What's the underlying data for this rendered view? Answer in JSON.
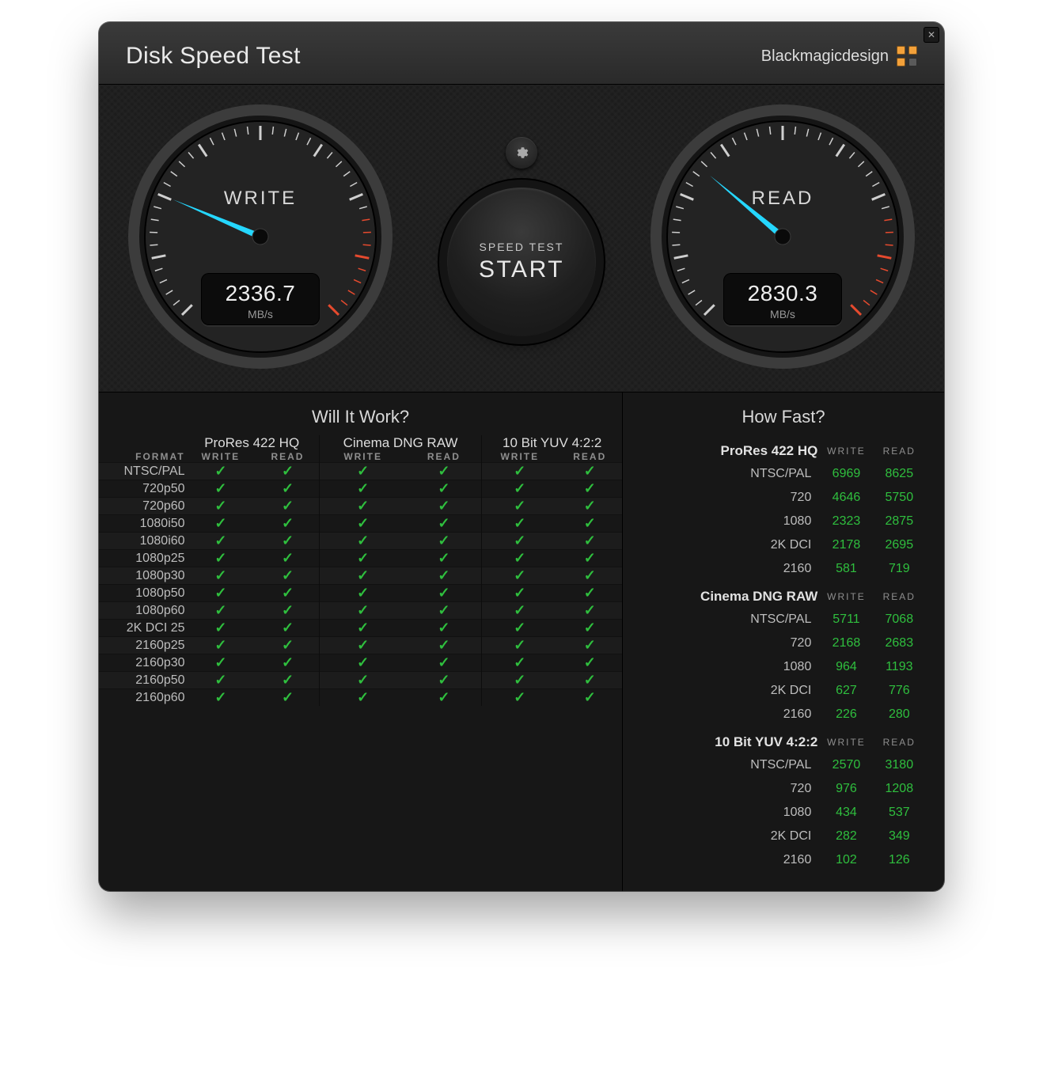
{
  "app": {
    "title": "Disk Speed Test",
    "brand": "Blackmagicdesign",
    "brand_colors": [
      "#f3a13a",
      "#f3a13a",
      "#f3a13a",
      "#5a5a5a"
    ]
  },
  "controls": {
    "start_line1": "SPEED TEST",
    "start_line2": "START",
    "settings_icon": "gear-icon"
  },
  "gauges": {
    "unit": "MB/s",
    "max": 8000,
    "write": {
      "label": "WRITE",
      "value": "2336.7",
      "needle_deg": -67
    },
    "read": {
      "label": "READ",
      "value": "2830.3",
      "needle_deg": -50
    }
  },
  "will_it_work": {
    "title": "Will It Work?",
    "format_header": "FORMAT",
    "sub_write": "WRITE",
    "sub_read": "READ",
    "codecs": [
      "ProRes 422 HQ",
      "Cinema DNG RAW",
      "10 Bit YUV 4:2:2"
    ],
    "formats": [
      "NTSC/PAL",
      "720p50",
      "720p60",
      "1080i50",
      "1080i60",
      "1080p25",
      "1080p30",
      "1080p50",
      "1080p60",
      "2K DCI 25",
      "2160p25",
      "2160p30",
      "2160p50",
      "2160p60"
    ],
    "all_checked": true
  },
  "how_fast": {
    "title": "How Fast?",
    "write_header": "WRITE",
    "read_header": "READ",
    "groups": [
      {
        "name": "ProRes 422 HQ",
        "rows": [
          {
            "label": "NTSC/PAL",
            "write": 6969,
            "read": 8625
          },
          {
            "label": "720",
            "write": 4646,
            "read": 5750
          },
          {
            "label": "1080",
            "write": 2323,
            "read": 2875
          },
          {
            "label": "2K DCI",
            "write": 2178,
            "read": 2695
          },
          {
            "label": "2160",
            "write": 581,
            "read": 719
          }
        ]
      },
      {
        "name": "Cinema DNG RAW",
        "rows": [
          {
            "label": "NTSC/PAL",
            "write": 5711,
            "read": 7068
          },
          {
            "label": "720",
            "write": 2168,
            "read": 2683
          },
          {
            "label": "1080",
            "write": 964,
            "read": 1193
          },
          {
            "label": "2K DCI",
            "write": 627,
            "read": 776
          },
          {
            "label": "2160",
            "write": 226,
            "read": 280
          }
        ]
      },
      {
        "name": "10 Bit YUV 4:2:2",
        "rows": [
          {
            "label": "NTSC/PAL",
            "write": 2570,
            "read": 3180
          },
          {
            "label": "720",
            "write": 976,
            "read": 1208
          },
          {
            "label": "1080",
            "write": 434,
            "read": 537
          },
          {
            "label": "2K DCI",
            "write": 282,
            "read": 349
          },
          {
            "label": "2160",
            "write": 102,
            "read": 126
          }
        ]
      }
    ]
  },
  "chart_data": [
    {
      "type": "gauge",
      "title": "WRITE",
      "value": 2336.7,
      "unit": "MB/s",
      "range": [
        0,
        8000
      ]
    },
    {
      "type": "gauge",
      "title": "READ",
      "value": 2830.3,
      "unit": "MB/s",
      "range": [
        0,
        8000
      ]
    }
  ]
}
